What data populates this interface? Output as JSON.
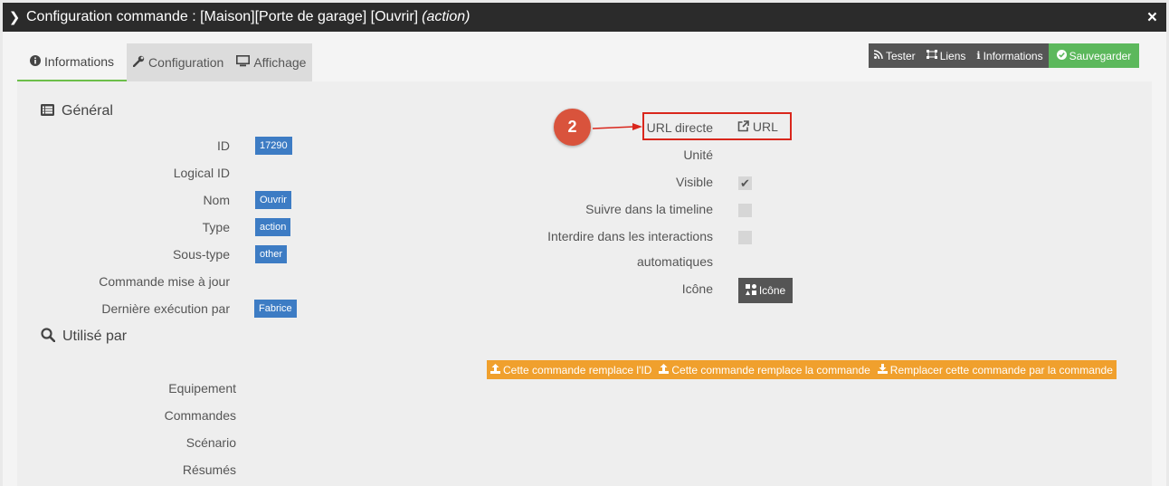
{
  "window": {
    "title": "Configuration commande : [Maison][Porte de garage] [Ouvrir]",
    "title_suffix": "(action)",
    "close_icon": "×"
  },
  "tabs": [
    {
      "label": "Informations",
      "icon": "info-circle-icon",
      "active": true
    },
    {
      "label": "Configuration",
      "icon": "wrench-icon",
      "active": false
    },
    {
      "label": "Affichage",
      "icon": "monitor-icon",
      "active": false
    }
  ],
  "toolbar": {
    "tester": "Tester",
    "liens": "Liens",
    "informations": "Informations",
    "sauvegarder": "Sauvegarder"
  },
  "general": {
    "title": "Général",
    "rows": [
      {
        "label": "ID",
        "value": "17290"
      },
      {
        "label": "Logical ID",
        "value": ""
      },
      {
        "label": "Nom",
        "value": "Ouvrir"
      },
      {
        "label": "Type",
        "value": "action"
      },
      {
        "label": "Sous-type",
        "value": "other"
      },
      {
        "label": "Commande mise à jour",
        "value": ""
      },
      {
        "label": "Dernière exécution par",
        "value": "Fabrice"
      }
    ]
  },
  "right": {
    "url_label": "URL directe",
    "url_link": "URL",
    "unite_label": "Unité",
    "visible_label": "Visible",
    "visible_checked": true,
    "timeline_label": "Suivre dans la timeline",
    "timeline_checked": false,
    "interdire_label_1": "Interdire dans les interactions",
    "interdire_label_2": "automatiques",
    "interdire_checked": false,
    "icone_label": "Icône",
    "icone_button": "Icône"
  },
  "annotation": {
    "number": "2",
    "color": "#d9261c"
  },
  "utilise": {
    "title": "Utilisé par",
    "rows": [
      "Equipement",
      "Commandes",
      "Scénario",
      "Résumés"
    ]
  },
  "replace_buttons": [
    "Cette commande remplace l'ID",
    "Cette commande remplace la commande",
    "Remplacer cette commande par la commande"
  ],
  "colors": {
    "header_bg": "#2b2b2b",
    "badge": "#3d7cc4",
    "save": "#5cb85c",
    "orange": "#f0a02d",
    "dark_button": "#555555"
  }
}
